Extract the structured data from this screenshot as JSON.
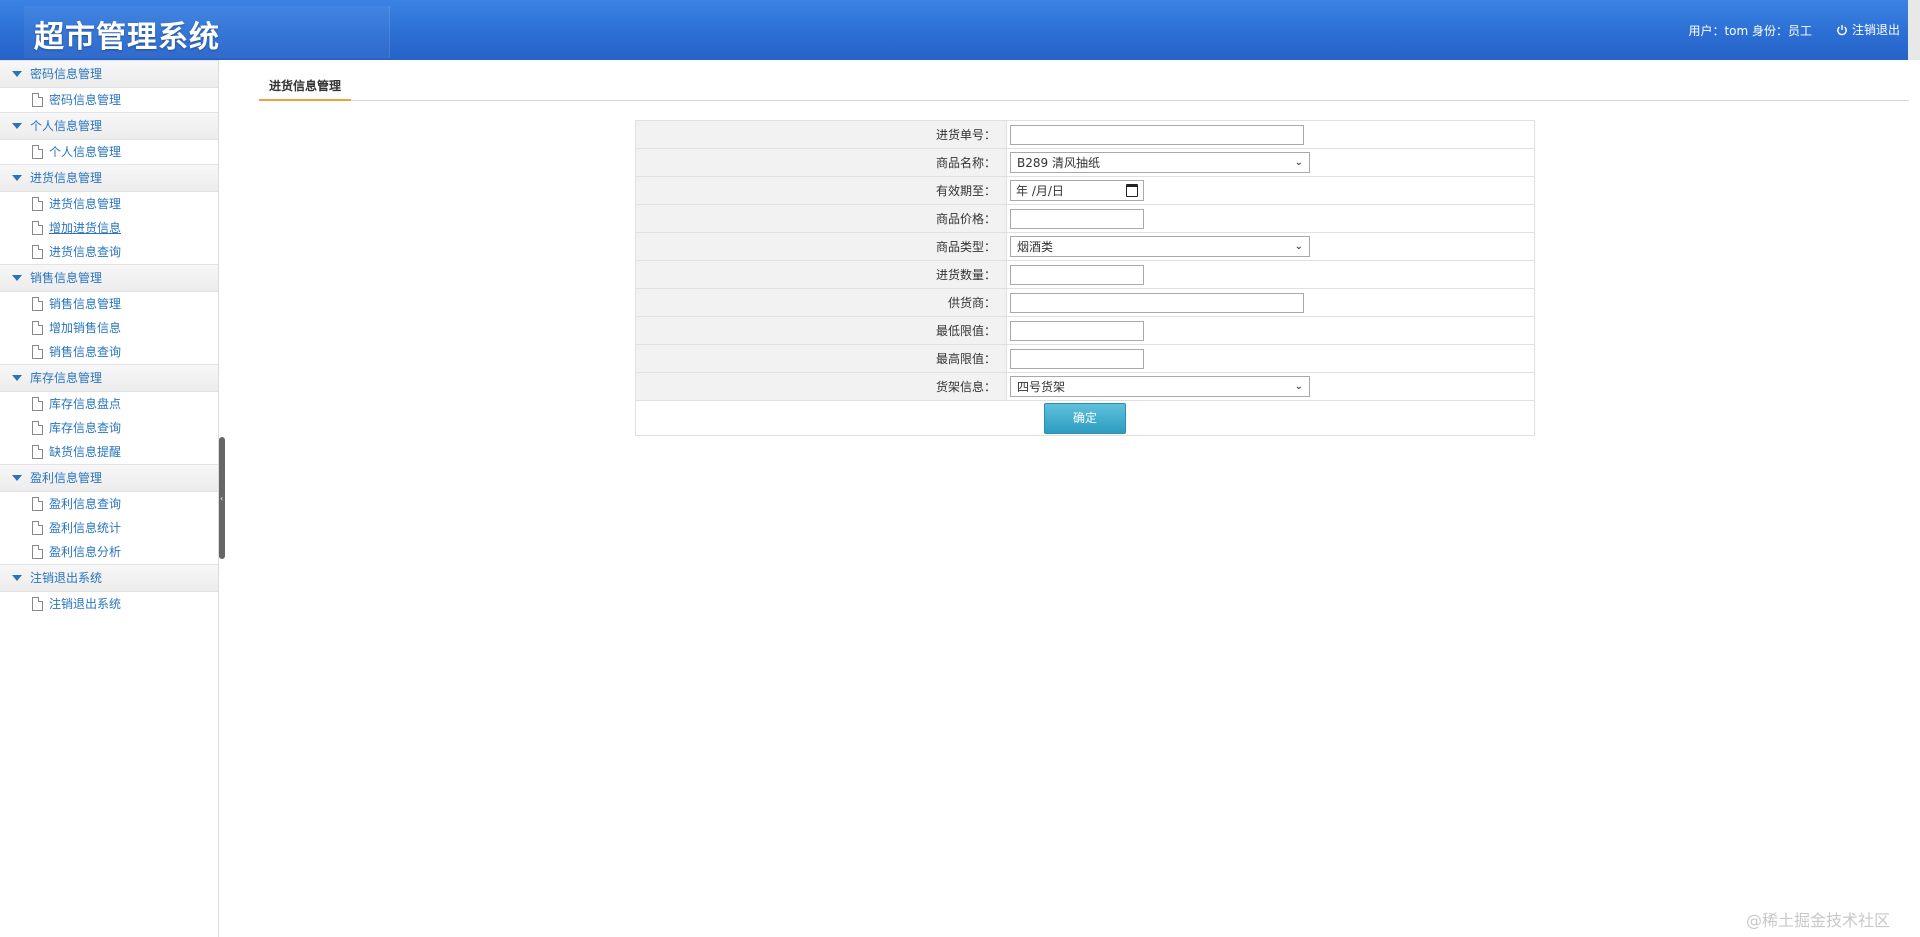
{
  "header": {
    "title": "超市管理系统",
    "user_info": "用户：tom 身份：员工",
    "logout_label": "注销退出"
  },
  "sidebar": {
    "groups": [
      {
        "title": "密码信息管理",
        "items": [
          "密码信息管理"
        ]
      },
      {
        "title": "个人信息管理",
        "items": [
          "个人信息管理"
        ]
      },
      {
        "title": "进货信息管理",
        "items": [
          "进货信息管理",
          "增加进货信息",
          "进货信息查询"
        ]
      },
      {
        "title": "销售信息管理",
        "items": [
          "销售信息管理",
          "增加销售信息",
          "销售信息查询"
        ]
      },
      {
        "title": "库存信息管理",
        "items": [
          "库存信息盘点",
          "库存信息查询",
          "缺货信息提醒"
        ]
      },
      {
        "title": "盈利信息管理",
        "items": [
          "盈利信息查询",
          "盈利信息统计",
          "盈利信息分析"
        ]
      },
      {
        "title": "注销退出系统",
        "items": [
          "注销退出系统"
        ]
      }
    ]
  },
  "main": {
    "tab_label": "进货信息管理",
    "form": {
      "order_no_label": "进货单号：",
      "order_no_value": "",
      "product_name_label": "商品名称：",
      "product_name_value": "B289 清风抽纸",
      "expiry_label": "有效期至：",
      "expiry_value": "年 /月/日",
      "price_label": "商品价格：",
      "price_value": "",
      "type_label": "商品类型：",
      "type_value": "烟酒类",
      "quantity_label": "进货数量：",
      "quantity_value": "",
      "supplier_label": "供货商：",
      "supplier_value": "",
      "min_label": "最低限值：",
      "min_value": "",
      "max_label": "最高限值：",
      "max_value": "",
      "shelf_label": "货架信息：",
      "shelf_value": "四号货架",
      "submit_label": "确定"
    }
  },
  "watermark": "@稀土掘金技术社区"
}
